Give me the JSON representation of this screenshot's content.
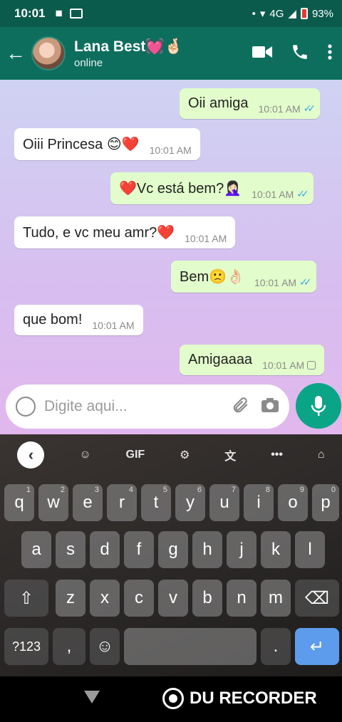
{
  "status_bar": {
    "time": "10:01",
    "network": "4G",
    "battery": "93%"
  },
  "header": {
    "contact_name": "Lana Best💓🤞🏻",
    "contact_status": "online",
    "back_icon": "arrow-left-icon",
    "video_icon": "video-camera-icon",
    "call_icon": "phone-icon",
    "menu_icon": "more-vertical-icon"
  },
  "messages": [
    {
      "direction": "out",
      "text": "Oii amiga",
      "time": "10:01 AM",
      "status": "read"
    },
    {
      "direction": "in",
      "text": "Oiii Princesa 😊❤️",
      "time": "10:01 AM"
    },
    {
      "direction": "out",
      "text": "❤️Vc está bem?🤦🏻‍♀️",
      "time": "10:01 AM",
      "status": "read"
    },
    {
      "direction": "in",
      "text": "Tudo, e vc meu amr?❤️",
      "time": "10:01 AM"
    },
    {
      "direction": "out",
      "text": "Bem🙁👌🏻",
      "time": "10:01 AM",
      "status": "read"
    },
    {
      "direction": "in",
      "text": "que bom!",
      "time": "10:01 AM"
    },
    {
      "direction": "out",
      "text": "Amigaaaa",
      "time": "10:01 AM",
      "status": "pending"
    }
  ],
  "composer": {
    "placeholder": "Digite aqui..."
  },
  "keyboard": {
    "toolbar": [
      "‹",
      "GIF",
      "•••"
    ],
    "row1": [
      [
        "q",
        "1"
      ],
      [
        "w",
        "2"
      ],
      [
        "e",
        "3"
      ],
      [
        "r",
        "4"
      ],
      [
        "t",
        "5"
      ],
      [
        "y",
        "6"
      ],
      [
        "u",
        "7"
      ],
      [
        "i",
        "8"
      ],
      [
        "o",
        "9"
      ],
      [
        "p",
        "0"
      ]
    ],
    "row2": [
      "a",
      "s",
      "d",
      "f",
      "g",
      "h",
      "j",
      "k",
      "l"
    ],
    "row3": [
      "z",
      "x",
      "c",
      "v",
      "b",
      "n",
      "m"
    ],
    "symbols_label": "?123",
    "comma": ",",
    "period": "."
  },
  "nav": {
    "recorder_label": "DU RECORDER"
  }
}
